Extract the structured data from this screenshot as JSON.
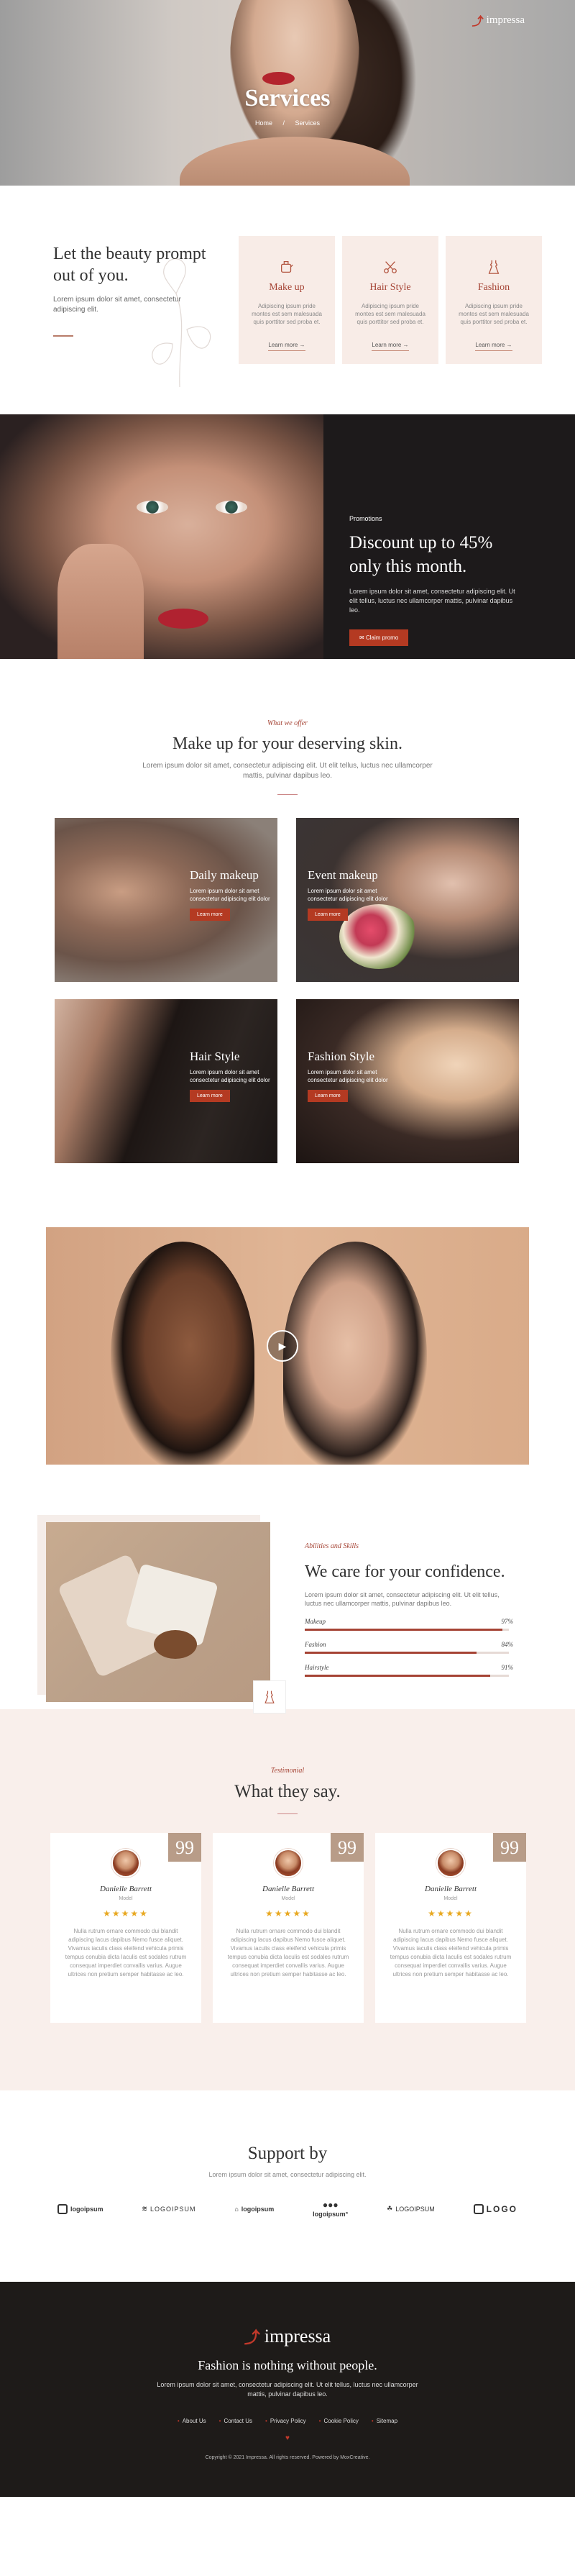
{
  "brand": {
    "name": "impressa",
    "accent": "#a54334",
    "button": "#b43a22",
    "footer_bg": "#1e1b19"
  },
  "hero": {
    "title": "Services",
    "breadcrumb": [
      "Home",
      "/",
      "Services"
    ]
  },
  "intro": {
    "heading": "Let the beauty prompt out of you.",
    "text": "Lorem ipsum dolor sit amet, consectetur adipiscing elit."
  },
  "service_cards": [
    {
      "icon": "makeup-icon",
      "title": "Make up",
      "text": "Adipiscing ipsum pride montes est sem malesuada quis porttitor sed proba et.",
      "link": "Learn more →"
    },
    {
      "icon": "scissors-icon",
      "title": "Hair Style",
      "text": "Adipiscing ipsum pride montes est sem malesuada quis porttitor sed proba et.",
      "link": "Learn more →"
    },
    {
      "icon": "dress-icon",
      "title": "Fashion",
      "text": "Adipiscing ipsum pride montes est sem malesuada quis porttitor sed proba et.",
      "link": "Learn more →"
    }
  ],
  "promo": {
    "eyebrow": "Promotions",
    "heading": "Discount up to 45% only this month.",
    "text": "Lorem ipsum dolor sit amet, consectetur adipiscing elit. Ut elit tellus, luctus nec ullamcorper mattis, pulvinar dapibus leo.",
    "button": "Claim promo"
  },
  "offer": {
    "eyebrow": "What we offer",
    "heading": "Make up for your deserving skin.",
    "text": "Lorem ipsum dolor sit amet, consectetur adipiscing elit. Ut elit tellus, luctus nec ullamcorper mattis, pulvinar dapibus leo.",
    "cards": [
      {
        "title": "Daily makeup",
        "text": "Lorem ipsum dolor sit amet consectetur adipiscing elit dolor",
        "button": "Learn more"
      },
      {
        "title": "Event makeup",
        "text": "Lorem ipsum dolor sit amet consectetur adipiscing elit dolor",
        "button": "Learn more"
      },
      {
        "title": "Hair Style",
        "text": "Lorem ipsum dolor sit amet consectetur adipiscing elit dolor",
        "button": "Learn more"
      },
      {
        "title": "Fashion Style",
        "text": "Lorem ipsum dolor sit amet consectetur adipiscing elit dolor",
        "button": "Learn more"
      }
    ]
  },
  "skills": {
    "eyebrow": "Abilities and Skills",
    "heading": "We care for your confidence.",
    "text": "Lorem ipsum dolor sit amet, consectetur adipiscing elit. Ut elit tellus, luctus nec ullamcorper mattis, pulvinar dapibus leo.",
    "bars": [
      {
        "label": "Makeup",
        "percent_label": "97%",
        "value": 97
      },
      {
        "label": "Fashion",
        "percent_label": "84%",
        "value": 84
      },
      {
        "label": "Hairstyle",
        "percent_label": "91%",
        "value": 91
      }
    ]
  },
  "testimonials": {
    "eyebrow": "Testimonial",
    "heading": "What they say.",
    "quote_mark": "99",
    "items": [
      {
        "name": "Danielle Barrett",
        "role": "Model",
        "stars": "★★★★★",
        "text": "Nulla rutrum ornare commodo dui blandit adipiscing lacus dapibus Nemo fusce aliquet. Vivamus iaculis class eleifend vehicula primis tempus conubia dicta Iaculis est sodales rutrum consequat imperdiet convallis varius. Augue ultrices non pretium semper habitasse ac leo."
      },
      {
        "name": "Danielle Barrett",
        "role": "Model",
        "stars": "★★★★★",
        "text": "Nulla rutrum ornare commodo dui blandit adipiscing lacus dapibus Nemo fusce aliquet. Vivamus iaculis class eleifend vehicula primis tempus conubia dicta Iaculis est sodales rutrum consequat imperdiet convallis varius. Augue ultrices non pretium semper habitasse ac leo."
      },
      {
        "name": "Danielle Barrett",
        "role": "Model",
        "stars": "★★★★★",
        "text": "Nulla rutrum ornare commodo dui blandit adipiscing lacus dapibus Nemo fusce aliquet. Vivamus iaculis class eleifend vehicula primis tempus conubia dicta Iaculis est sodales rutrum consequat imperdiet convallis varius. Augue ultrices non pretium semper habitasse ac leo."
      }
    ]
  },
  "support": {
    "heading": "Support by",
    "text": "Lorem ipsum dolor sit amet, consectetur adipiscing elit.",
    "logos": [
      "logoipsum",
      "LOGOIPSUM",
      "logoipsum",
      "logoipsum°",
      "LOGOIPSUM",
      "LOGO"
    ]
  },
  "footer": {
    "tagline": "Fashion is nothing without people.",
    "text": "Lorem ipsum dolor sit amet, consectetur adipiscing elit. Ut elit tellus, luctus nec ullamcorper mattis, pulvinar dapibus leo.",
    "links": [
      "About Us",
      "Contact Us",
      "Privacy Policy",
      "Cookie Policy",
      "Sitemap"
    ],
    "heart": "♥",
    "copyright": "Copyright © 2021 Impressa. All rights reserved. Powered by MoxCreative."
  }
}
